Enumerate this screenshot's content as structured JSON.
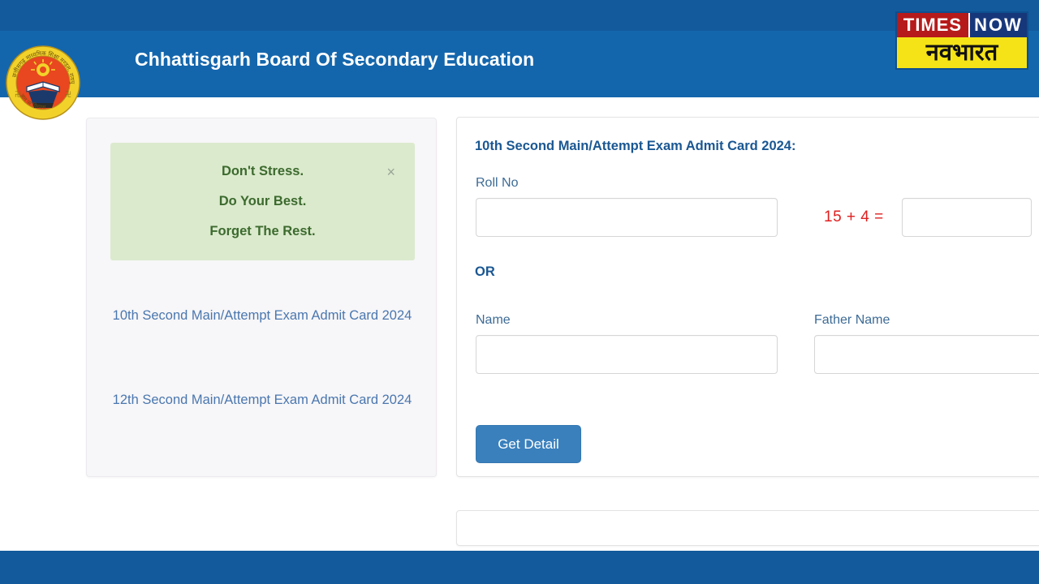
{
  "header": {
    "title": "Chhattisgarh Board Of Secondary Education",
    "bg_color": "#1466ac",
    "top_strip_color": "#125a9c",
    "board_logo_name": "cgbse-board-emblem"
  },
  "brand_logo": {
    "times": "TIMES",
    "now": "NOW",
    "navbharat": "नवभारत",
    "times_bg": "#b61a1a",
    "now_bg": "#16377a",
    "navbharat_bg": "#f5e317"
  },
  "left_card": {
    "alert": {
      "lines": [
        "Don't Stress.",
        "Do Your Best.",
        "Forget The Rest."
      ],
      "close_label": "×",
      "bg_color": "#dbeacd",
      "text_color": "#3c6a2e"
    },
    "links": [
      "10th Second Main/Attempt Exam Admit Card 2024",
      "12th Second Main/Attempt Exam Admit Card 2024"
    ],
    "link_color": "#4a77af"
  },
  "form": {
    "title": "10th Second Main/Attempt Exam Admit Card 2024:",
    "roll_no_label": "Roll No",
    "roll_no_value": "",
    "captcha_expression": "15 + 4 =",
    "captcha_value": "",
    "captcha_color": "#e02020",
    "or_label": "OR",
    "name_label": "Name",
    "name_value": "",
    "father_name_label": "Father Name",
    "father_name_value": "",
    "submit_label": "Get Detail",
    "submit_color": "#3a80bd"
  },
  "footer": {
    "band_color": "#125a9c"
  }
}
